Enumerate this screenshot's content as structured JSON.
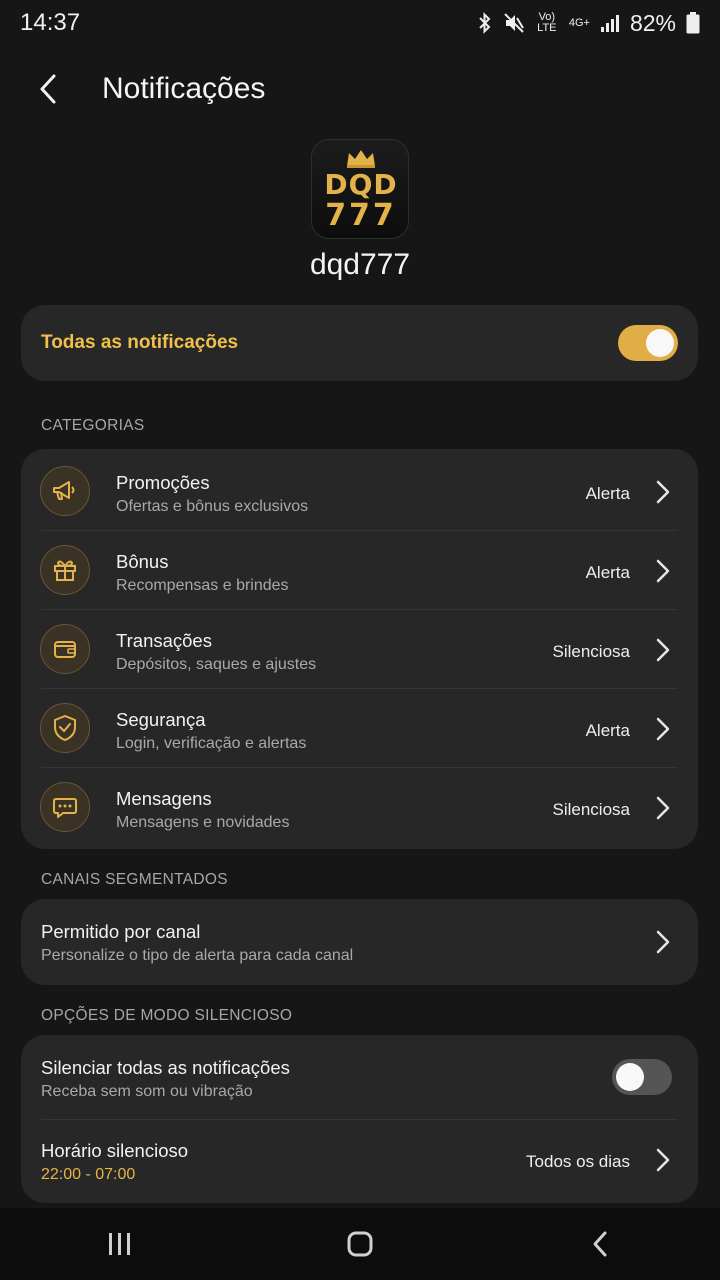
{
  "status_bar": {
    "time": "14:37",
    "battery": "82%",
    "icons": [
      "bluetooth-icon",
      "mute-icon",
      "volte-icon",
      "4g-icon",
      "signal-icon",
      "battery-icon"
    ],
    "volte_text": "Vo) LTE",
    "network_text": "4G+"
  },
  "header": {
    "title": "Notificações",
    "back_icon": "back-arrow-icon"
  },
  "app": {
    "name": "dqd777",
    "logo_line1": "DQD",
    "logo_line2": "777",
    "logo_icon": "crown-icon"
  },
  "master": {
    "label": "Todas as notificações",
    "enabled": true
  },
  "sections": {
    "categories": "CATEGORIAS",
    "channels": "CANAIS SEGMENTADOS",
    "silent": "OPÇÕES DE MODO SILENCIOSO"
  },
  "categories": [
    {
      "title": "Promoções",
      "subtitle": "Ofertas e bônus exclusivos",
      "value": "Alerta",
      "icon": "megaphone-icon"
    },
    {
      "title": "Bônus",
      "subtitle": "Recompensas e brindes",
      "value": "Alerta",
      "icon": "gift-icon"
    },
    {
      "title": "Transações",
      "subtitle": "Depósitos, saques e ajustes",
      "value": "Silenciosa",
      "icon": "wallet-icon"
    },
    {
      "title": "Segurança",
      "subtitle": "Login, verificação e alertas",
      "value": "Alerta",
      "icon": "shield-icon"
    },
    {
      "title": "Mensagens",
      "subtitle": "Mensagens e novidades",
      "value": "Silenciosa",
      "icon": "chat-bubble-icon"
    }
  ],
  "channels": {
    "title": "Permitido por canal",
    "subtitle": "Personalize o tipo de alerta para cada canal"
  },
  "silent": {
    "mute_all_title": "Silenciar todas as notificações",
    "mute_all_subtitle": "Receba sem som ou vibração",
    "mute_all_enabled": false,
    "schedule_title": "Horário silencioso",
    "schedule_time": "22:00 - 07:00",
    "schedule_value": "Todos os dias"
  },
  "nav": {
    "icons": [
      "recent-apps-icon",
      "home-icon",
      "back-icon"
    ]
  },
  "colors": {
    "accent": "#e0ad47",
    "background": "#161616",
    "card": "#272727"
  }
}
